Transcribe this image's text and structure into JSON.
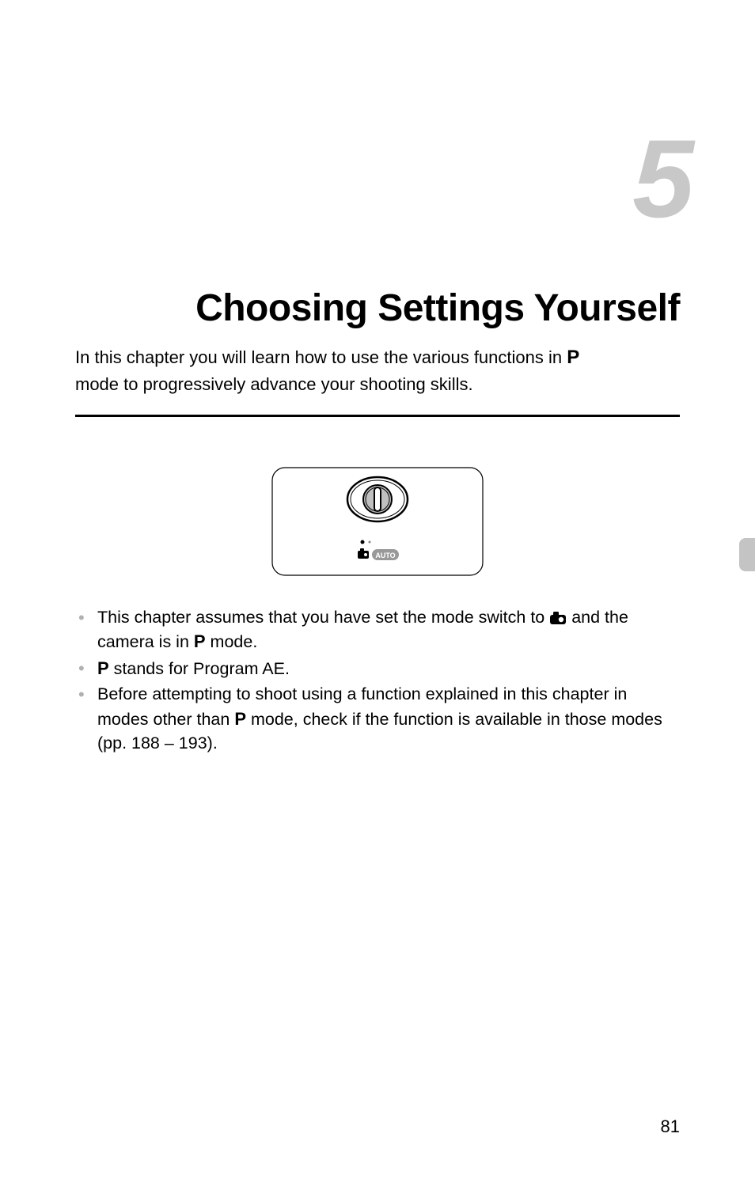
{
  "chapter_number": "5",
  "chapter_title": "Choosing Settings Yourself",
  "intro_part1": "In this chapter you will learn how to use the various functions in ",
  "intro_part2": " mode to progressively advance your shooting skills.",
  "icons": {
    "p_mode": "P",
    "camera_mode": "camera-icon",
    "auto_mode": "AUTO"
  },
  "bullets": {
    "item1_part1": "This chapter assumes that you have set the mode switch to ",
    "item1_part2": " and the camera is in ",
    "item1_part3": " mode.",
    "item2_part1": "",
    "item2_part2": " stands for Program AE.",
    "item3_part1": "Before attempting to shoot using a function explained in this chapter in modes other than ",
    "item3_part2": " mode, check if the function is available in those modes (pp. 188 – 193)."
  },
  "page_number": "81"
}
